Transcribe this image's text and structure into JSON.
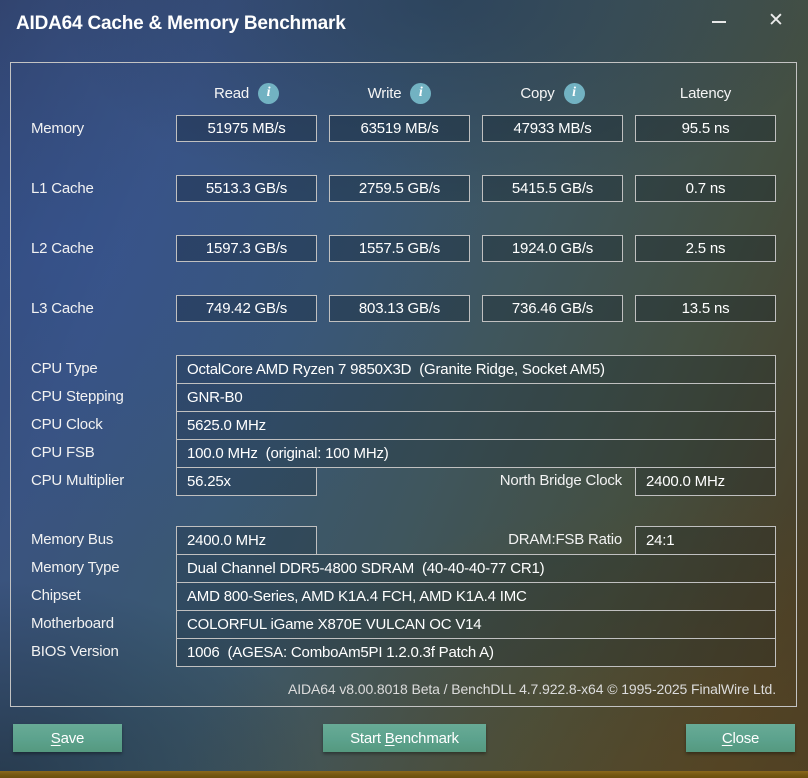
{
  "window": {
    "title": "AIDA64 Cache & Memory Benchmark",
    "close_glyph": "✕"
  },
  "benchmark": {
    "columns": [
      {
        "label": "Read",
        "info_icon_glyph": "i"
      },
      {
        "label": "Write",
        "info_icon_glyph": "i"
      },
      {
        "label": "Copy",
        "info_icon_glyph": "i"
      },
      {
        "label": "Latency"
      }
    ],
    "rows": [
      {
        "label": "Memory",
        "values": [
          "51975 MB/s",
          "63519 MB/s",
          "47933 MB/s",
          "95.5 ns"
        ]
      },
      {
        "label": "L1 Cache",
        "values": [
          "5513.3 GB/s",
          "2759.5 GB/s",
          "5415.5 GB/s",
          "0.7 ns"
        ]
      },
      {
        "label": "L2 Cache",
        "values": [
          "1597.3 GB/s",
          "1557.5 GB/s",
          "1924.0 GB/s",
          "2.5 ns"
        ]
      },
      {
        "label": "L3 Cache",
        "values": [
          "749.42 GB/s",
          "803.13 GB/s",
          "736.46 GB/s",
          "13.5 ns"
        ]
      }
    ]
  },
  "cpu_info": {
    "rows": [
      {
        "label": "CPU Type",
        "value": "OctalCore AMD Ryzen 7 9850X3D  (Granite Ridge, Socket AM5)"
      },
      {
        "label": "CPU Stepping",
        "value": "GNR-B0"
      },
      {
        "label": "CPU Clock",
        "value": "5625.0 MHz"
      },
      {
        "label": "CPU FSB",
        "value": "100.0 MHz  (original: 100 MHz)"
      }
    ],
    "multiplier_row": {
      "label": "CPU Multiplier",
      "value": "56.25x",
      "right_label": "North Bridge Clock",
      "right_value": "2400.0 MHz"
    }
  },
  "memory_info": {
    "bus_row": {
      "label": "Memory Bus",
      "value": "2400.0 MHz",
      "right_label": "DRAM:FSB Ratio",
      "right_value": "24:1"
    },
    "rows": [
      {
        "label": "Memory Type",
        "value": "Dual Channel DDR5-4800 SDRAM  (40-40-40-77 CR1)"
      },
      {
        "label": "Chipset",
        "value": "AMD 800-Series, AMD K1A.4 FCH, AMD K1A.4 IMC"
      },
      {
        "label": "Motherboard",
        "value": "COLORFUL iGame X870E VULCAN OC V14"
      },
      {
        "label": "BIOS Version",
        "value": "1006  (AGESA: ComboAm5PI 1.2.0.3f Patch A)"
      }
    ]
  },
  "footer": {
    "version_text": "AIDA64 v8.00.8018 Beta / BenchDLL 4.7.922.8-x64 © 1995-2025 FinalWire Ltd."
  },
  "buttons": {
    "save": {
      "pre": "",
      "mnemonic": "S",
      "post": "ave"
    },
    "start": {
      "pre": "Start ",
      "mnemonic": "B",
      "post": "enchmark"
    },
    "close": {
      "pre": "",
      "mnemonic": "C",
      "post": "lose"
    }
  },
  "colors": {
    "button_teal": "#5ca28d",
    "info_icon_teal": "#72b2c2",
    "panel_border": "#c3c3c3",
    "bottom_bar_gold": "#735610"
  }
}
